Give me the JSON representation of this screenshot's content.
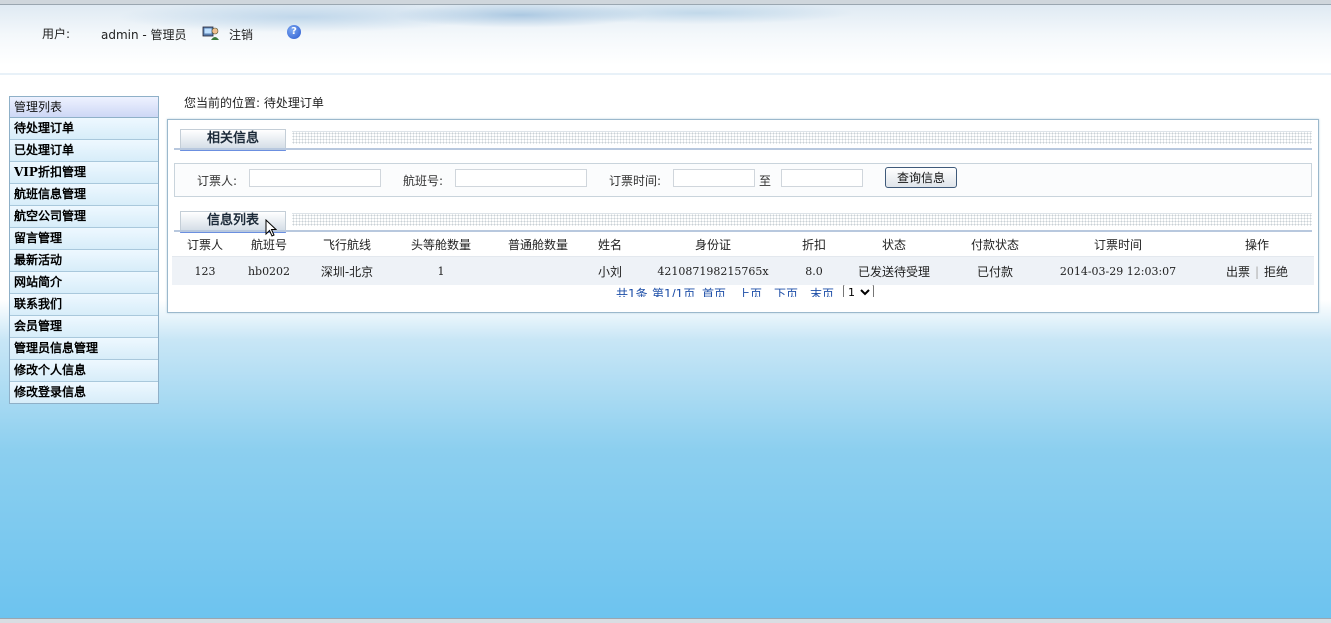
{
  "header": {
    "user_label": "用户:",
    "user_name": "admin - 管理员",
    "logout_label": "注销",
    "help_glyph": "?"
  },
  "sidebar": {
    "title": "管理列表",
    "items": [
      "待处理订单",
      "已处理订单",
      "VIP折扣管理",
      "航班信息管理",
      "航空公司管理",
      "留言管理",
      "最新活动",
      "网站简介",
      "联系我们",
      "会员管理",
      "管理员信息管理",
      "修改个人信息",
      "修改登录信息"
    ]
  },
  "breadcrumb": "您当前的位置: 待处理订单",
  "search": {
    "section_title": "相关信息",
    "booker_label": "订票人:",
    "booker_value": "",
    "flight_label": "航班号:",
    "flight_value": "",
    "time_label": "订票时间:",
    "time_from": "",
    "to_label": "至",
    "time_to": "",
    "button_label": "查询信息"
  },
  "list": {
    "section_title": "信息列表",
    "columns": [
      "订票人",
      "航班号",
      "飞行航线",
      "头等舱数量",
      "普通舱数量",
      "姓名",
      "身份证",
      "折扣",
      "状态",
      "付款状态",
      "订票时间",
      "操作"
    ],
    "rows": [
      {
        "booker": "123",
        "flight": "hb0202",
        "route": "深圳-北京",
        "first_class": "1",
        "economy": "",
        "name": "小刘",
        "id_card": "421087198215765x",
        "discount": "8.0",
        "status": "已发送待受理",
        "payment": "已付款",
        "time": "2014-03-29 12:03:07",
        "action_issue": "出票",
        "action_reject": "拒绝"
      }
    ]
  },
  "pager": {
    "total": "共1条",
    "page_info": "第1/1页",
    "first": "首页",
    "prev": "上页",
    "next": "下页",
    "last": "末页",
    "current": "1"
  },
  "colors": {
    "accent_blue": "#6b8fe0",
    "link_blue": "#1e4fa8",
    "sky_bottom": "#6cc3ef"
  }
}
